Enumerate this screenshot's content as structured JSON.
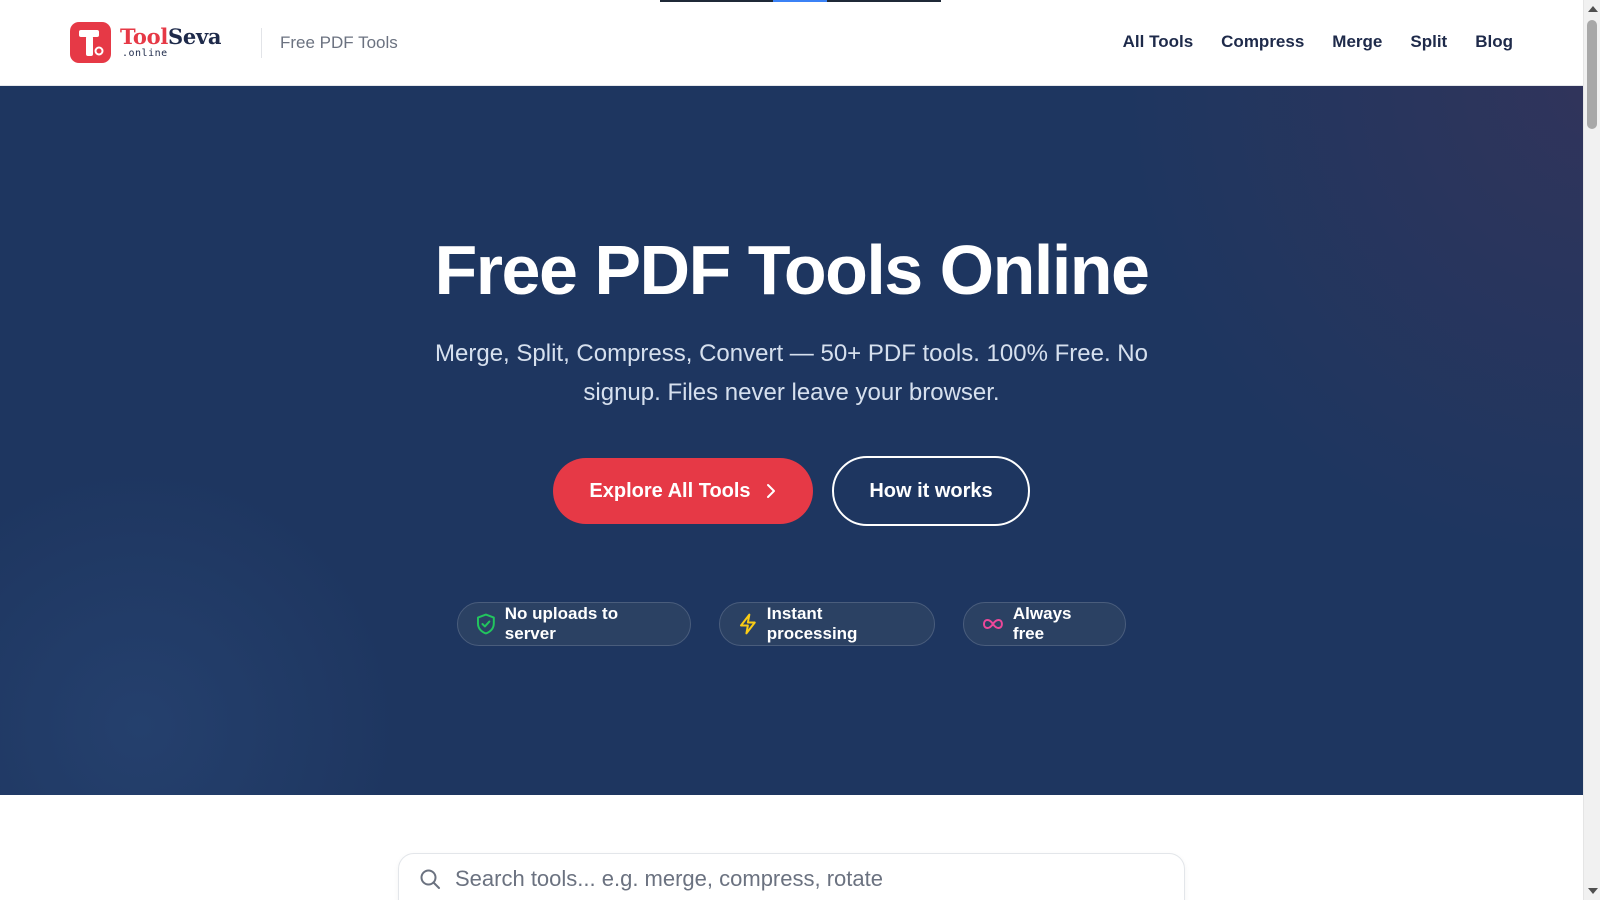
{
  "header": {
    "brand_part1": "Tool",
    "brand_part2": "Seva",
    "brand_suffix": ".online",
    "tagline": "Free PDF Tools",
    "nav": [
      {
        "label": "All Tools"
      },
      {
        "label": "Compress"
      },
      {
        "label": "Merge"
      },
      {
        "label": "Split"
      },
      {
        "label": "Blog"
      }
    ]
  },
  "hero": {
    "title": "Free PDF Tools Online",
    "subtitle": "Merge, Split, Compress, Convert — 50+ PDF tools. 100% Free. No signup. Files never leave your browser.",
    "primary_button": "Explore All Tools",
    "secondary_button": "How it works",
    "badges": [
      {
        "label": "No uploads to server",
        "icon": "shield-check-icon",
        "color": "#22c55e"
      },
      {
        "label": "Instant processing",
        "icon": "lightning-icon",
        "color": "#facc15"
      },
      {
        "label": "Always free",
        "icon": "infinity-icon",
        "color": "#ec4899"
      }
    ]
  },
  "search": {
    "placeholder": "Search tools... e.g. merge, compress, rotate",
    "value": ""
  },
  "colors": {
    "brand_red": "#e63946",
    "navy": "#1e2a4a",
    "hero_bg": "#1e3660"
  }
}
